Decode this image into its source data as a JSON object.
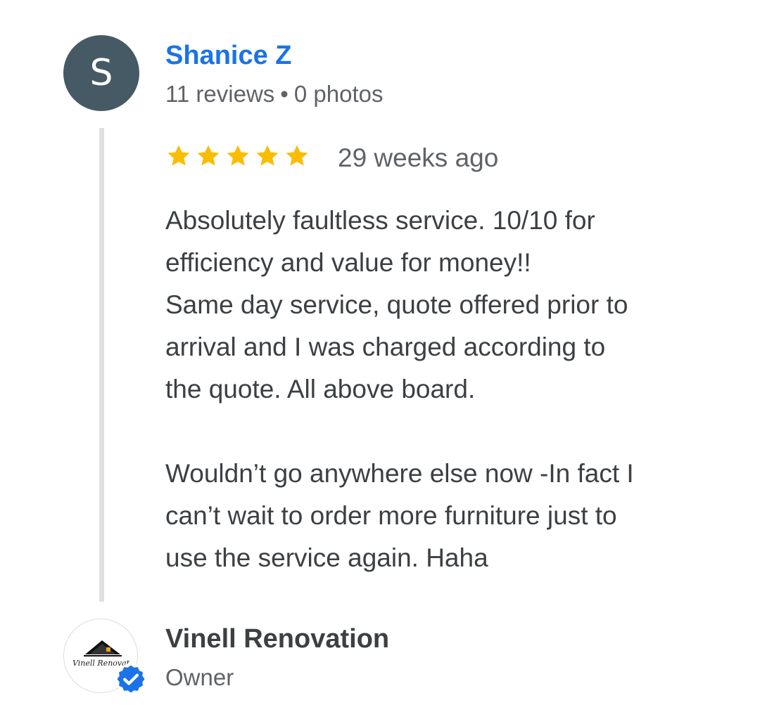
{
  "review": {
    "reviewer": {
      "initial": "S",
      "name": "Shanice Z",
      "reviews": "11 reviews",
      "separator": "•",
      "photos": "0 photos",
      "avatar_color": "#455a64",
      "name_color": "#1a73e8"
    },
    "rating": {
      "value": 5,
      "max": 5,
      "star_color": "#fbbc04"
    },
    "date": "29 weeks ago",
    "text_lines": [
      "Absolutely faultless service. 10/10 for",
      "efficiency and value for money!!",
      "Same day service, quote offered prior to",
      "arrival and I was charged according to",
      "the quote. All above board.",
      "",
      "Wouldn’t go anywhere else now -In fact I",
      "can’t wait to order more furniture just to",
      "use the service again. Haha"
    ]
  },
  "owner_response": {
    "name": "Vinell Renovation",
    "role": "Owner",
    "logo_text": "Vinell Renovat",
    "logo_icon": "house-roof-icon",
    "badge_icon": "verified-check-icon",
    "badge_color": "#1a73e8"
  }
}
